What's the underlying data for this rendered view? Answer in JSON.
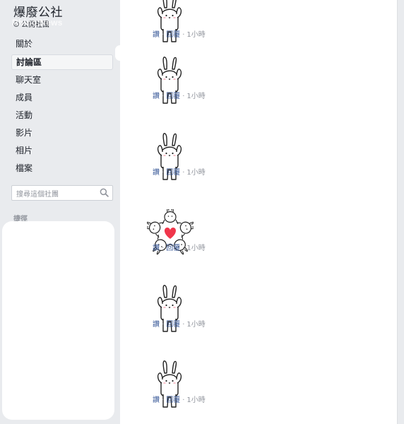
{
  "group": {
    "title": "爆廢公社",
    "privacy": "公開社團",
    "watermark": "Rhino News"
  },
  "nav": {
    "items": [
      {
        "label": "關於"
      },
      {
        "label": "討論區"
      },
      {
        "label": "聊天室"
      },
      {
        "label": "成員"
      },
      {
        "label": "活動"
      },
      {
        "label": "影片"
      },
      {
        "label": "相片"
      },
      {
        "label": "檔案"
      }
    ],
    "active_index": 1
  },
  "search": {
    "placeholder": "搜尋這個社團"
  },
  "shortcuts": {
    "label": "捷徑"
  },
  "comments": [
    {
      "sticker": "bunny-sticker",
      "like": "讚",
      "reply": "回覆",
      "time": "1小時"
    },
    {
      "sticker": "bunny-sticker",
      "like": "讚",
      "reply": "回覆",
      "time": "1小時"
    },
    {
      "sticker": "bunny-sticker",
      "like": "讚",
      "reply": "回覆",
      "time": "1小時"
    },
    {
      "sticker": "bunny-heart-star-sticker",
      "like": "讚",
      "reply": "回覆",
      "time": "1小時"
    },
    {
      "sticker": "bunny-sticker",
      "like": "讚",
      "reply": "回覆",
      "time": "1小時"
    },
    {
      "sticker": "bunny-sticker",
      "like": "讚",
      "reply": "回覆",
      "time": "1小時"
    }
  ],
  "separator": "·",
  "colors": {
    "link": "#385898",
    "meta": "#90949c",
    "heart": "#f0364b",
    "sidebar_bg": "#e9ebee"
  }
}
